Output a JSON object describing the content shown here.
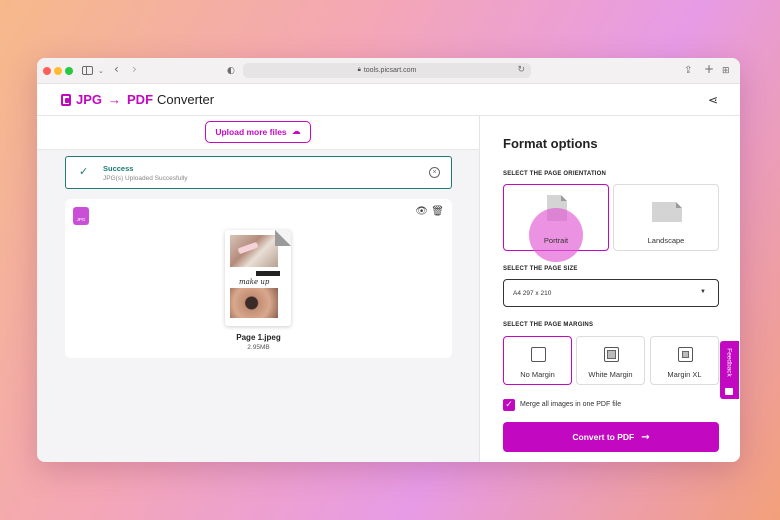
{
  "browser": {
    "url": "tools.picsart.com",
    "icons": {
      "sidebar": "sidebar-icon",
      "back": "chevron-left-icon",
      "forward": "chevron-right-icon",
      "privacy": "shield-icon",
      "reload": "reload-icon",
      "share": "share-icon",
      "new_tab": "plus-icon",
      "tabs": "grid-icon"
    }
  },
  "header": {
    "logo_from": "JPG",
    "logo_to": "PDF",
    "logo_suffix": "Converter",
    "share_icon": "share-nodes-icon",
    "brand_color": "#c209c1"
  },
  "upload": {
    "button_label": "Upload more files"
  },
  "alert": {
    "title": "Success",
    "message": "JPG(s) Uploaded Succesfully",
    "color": "#1e7a73"
  },
  "file": {
    "badge": "JPG",
    "name": "Page 1.jpeg",
    "size": "2.95MB",
    "thumb_script": "make up"
  },
  "format": {
    "title": "Format options",
    "orientation_label": "SELECT THE PAGE ORIENTATION",
    "orientations": [
      {
        "label": "Portrait",
        "selected": true
      },
      {
        "label": "Landscape",
        "selected": false
      }
    ],
    "size_label": "SELECT THE PAGE SIZE",
    "size_value": "A4 297 x 210",
    "margins_label": "SELECT THE PAGE MARGINS",
    "margins": [
      {
        "label": "No Margin",
        "selected": true
      },
      {
        "label": "White Margin",
        "selected": false
      },
      {
        "label": "Margin XL",
        "selected": false
      }
    ],
    "merge_label": "Merge all images in one PDF file",
    "merge_checked": true,
    "convert_label": "Convert to PDF"
  },
  "feedback": {
    "label": "Feedback"
  }
}
